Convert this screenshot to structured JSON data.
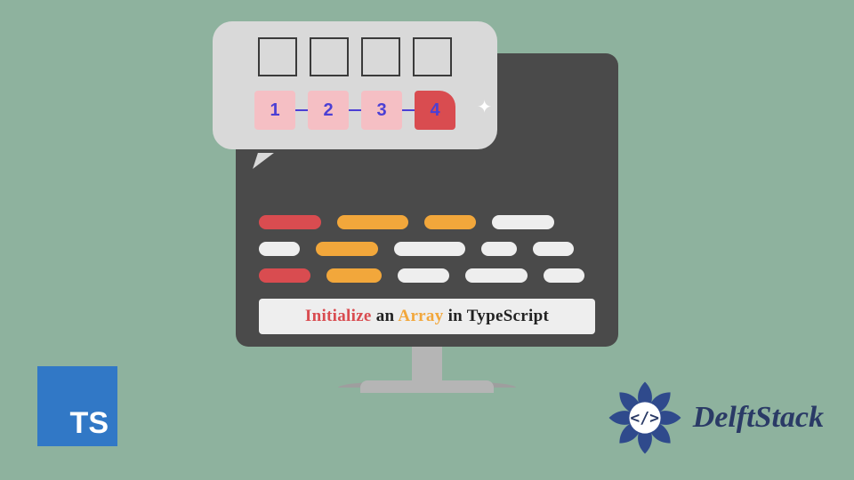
{
  "background_color": "#8eb29e",
  "ts_badge": {
    "label": "TS",
    "color": "#3178c6"
  },
  "delftstack": {
    "brand": "DelftStack",
    "icon_text": "</>"
  },
  "title": {
    "word1": "Initialize",
    "word2": "an",
    "word3": "Array",
    "rest": "in TypeScript"
  },
  "bubble": {
    "empty_slots": 4,
    "values": [
      "1",
      "2",
      "3",
      "4"
    ],
    "highlight_index": 3
  },
  "code_lines": [
    [
      {
        "c": "c-red",
        "w": "w3"
      },
      {
        "c": "c-orange",
        "w": "w4"
      },
      {
        "c": "c-orange",
        "w": "w2"
      },
      {
        "c": "c-white",
        "w": "w3"
      }
    ],
    [
      {
        "c": "c-white",
        "w": "w5"
      },
      {
        "c": "c-orange",
        "w": "w3"
      },
      {
        "c": "c-white",
        "w": "w4"
      },
      {
        "c": "c-white",
        "w": "w1"
      },
      {
        "c": "c-white",
        "w": "w5"
      }
    ],
    [
      {
        "c": "c-red",
        "w": "w2"
      },
      {
        "c": "c-orange",
        "w": "w6"
      },
      {
        "c": "c-white",
        "w": "w2"
      },
      {
        "c": "c-white",
        "w": "w3"
      },
      {
        "c": "c-white",
        "w": "w5"
      }
    ]
  ]
}
